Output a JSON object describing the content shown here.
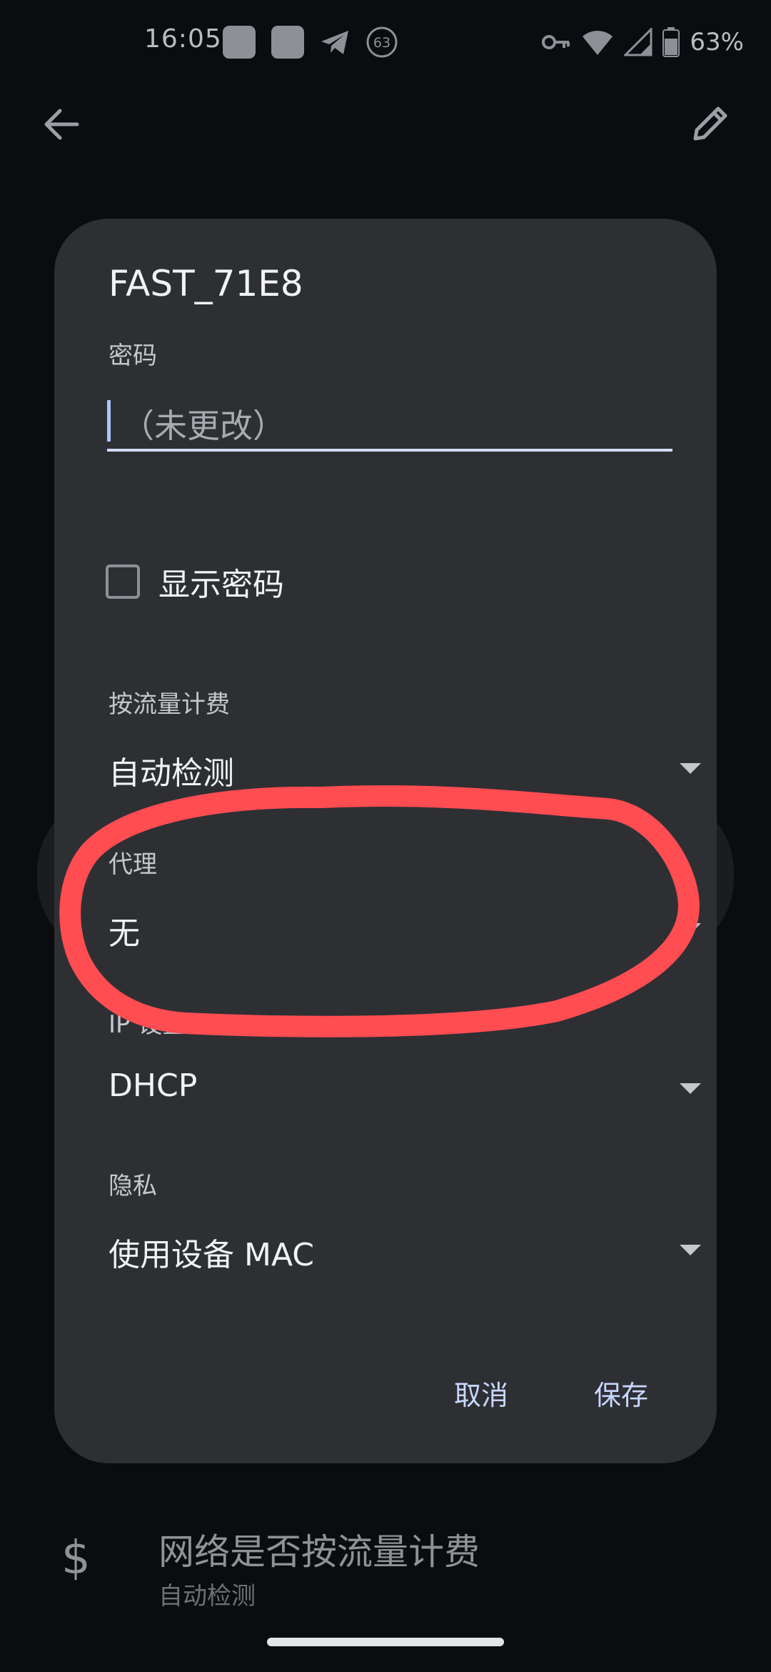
{
  "status_bar": {
    "time": "16:05",
    "notification_badge": "63",
    "battery_percent": "63%",
    "icons": [
      "app-square-icon",
      "app-square-icon",
      "telegram-icon",
      "data-saver-icon",
      "key-icon",
      "wifi-icon",
      "signal-icon",
      "battery-icon"
    ]
  },
  "background_page": {
    "metered_title": "网络是否按流量计费",
    "metered_subtitle": "自动检测",
    "icons": [
      "back-arrow-icon",
      "edit-pencil-icon",
      "dollar-icon"
    ]
  },
  "dialog": {
    "title": "FAST_71E8",
    "password_label": "密码",
    "password_placeholder": "（未更改）",
    "show_password_label": "显示密码",
    "show_password_checked": false,
    "metered_label": "按流量计费",
    "metered_value": "自动检测",
    "proxy_label": "代理",
    "proxy_value": "无",
    "ip_settings_label": "IP 设置",
    "ip_settings_value": "DHCP",
    "privacy_label": "隐私",
    "privacy_value": "使用设备 MAC",
    "cancel_label": "取消",
    "save_label": "保存"
  },
  "colors": {
    "background": "#0b0c0f",
    "dialog": "#2e2f33",
    "accent": "#c9d7ff",
    "annotation": "#ff4d52"
  }
}
